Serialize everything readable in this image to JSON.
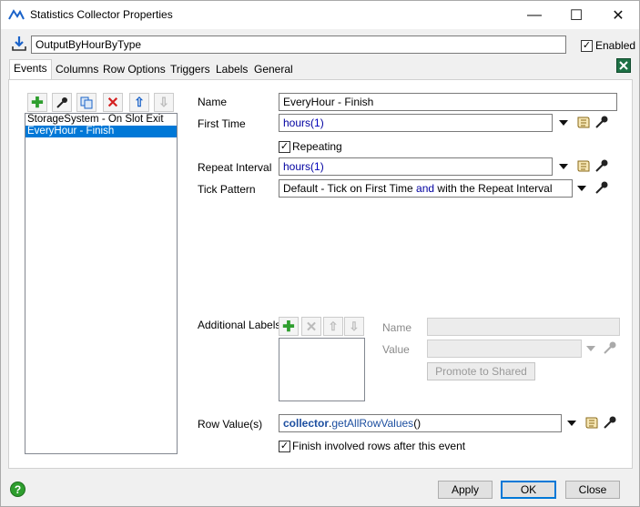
{
  "window": {
    "title": "Statistics Collector Properties",
    "minimize_glyph": "—",
    "maximize_glyph": "☐",
    "close_glyph": "✕"
  },
  "header": {
    "name_value": "OutputByHourByType",
    "enabled_label": "Enabled",
    "enabled_checked": true
  },
  "tabs": [
    {
      "label": "Events",
      "active": true
    },
    {
      "label": "Columns"
    },
    {
      "label": "Row Options"
    },
    {
      "label": "Triggers"
    },
    {
      "label": "Labels"
    },
    {
      "label": "General"
    }
  ],
  "events_list": {
    "items": [
      {
        "label": "StorageSystem - On Slot Exit",
        "selected": false
      },
      {
        "label": "EveryHour - Finish",
        "selected": true
      }
    ]
  },
  "form": {
    "name_label": "Name",
    "name_value": "EveryHour - Finish",
    "first_time_label": "First Time",
    "first_time_fn": "hours(",
    "first_time_arg": "1",
    "first_time_close": ")",
    "repeating_label": "Repeating",
    "repeating_checked": true,
    "repeat_interval_label": "Repeat Interval",
    "repeat_interval_fn": "hours(",
    "repeat_interval_arg": "1",
    "repeat_interval_close": ")",
    "tick_pattern_label": "Tick Pattern",
    "tick_pattern_part1": "Default - Tick on First Time ",
    "tick_pattern_and": "and",
    "tick_pattern_part2": " with the Repeat Interval",
    "additional_labels_label": "Additional Labels",
    "al_name_label": "Name",
    "al_value_label": "Value",
    "promote_label": "Promote to Shared",
    "row_values_label": "Row Value(s)",
    "row_values_obj": "collector",
    "row_values_dot": ".",
    "row_values_fn": "getAllRowValues",
    "row_values_paren": "()",
    "finish_rows_label": "Finish involved rows after this event",
    "finish_rows_checked": true
  },
  "footer": {
    "help_glyph": "?",
    "apply_label": "Apply",
    "ok_label": "OK",
    "close_label": "Close"
  },
  "icons": {
    "toolbar": [
      "add-icon",
      "sampler-icon",
      "duplicate-icon",
      "delete-icon",
      "move-up-icon",
      "move-down-icon"
    ],
    "field_icons": [
      "dropdown-arrow-icon",
      "script-icon",
      "sampler-icon"
    ],
    "window_icon": "statistics-collector-icon",
    "name_icon": "download-arrow-icon",
    "excel_icon": "excel-export-icon"
  },
  "colors": {
    "accent": "#0078d7",
    "selection": "#0078d7",
    "add_green": "#2e9e2e",
    "delete_red": "#d42020",
    "move_blue": "#1b63c9"
  }
}
